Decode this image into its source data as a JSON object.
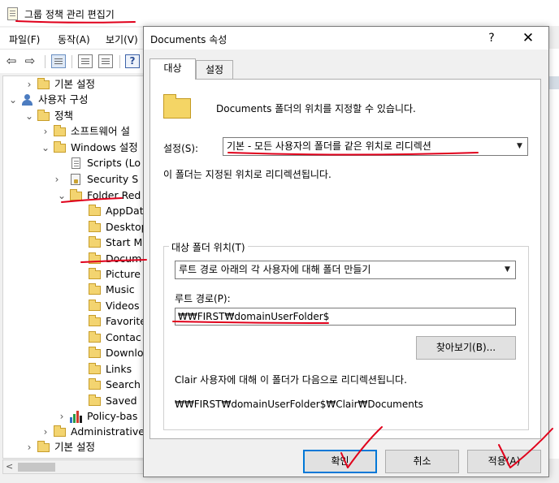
{
  "window": {
    "title": "그룹 정책 관리 편집기"
  },
  "menu": {
    "items": [
      "파일(F)",
      "동작(A)",
      "보기(V)"
    ]
  },
  "toolbar": {
    "back_icon": "back-arrow-icon",
    "forward_icon": "forward-arrow-icon",
    "help_label": "?"
  },
  "tree": {
    "nodes": [
      {
        "label": "기본 설정",
        "expander": "›"
      },
      {
        "label": "사용자 구성",
        "expander": "⌄"
      },
      {
        "label": "정책",
        "expander": "⌄"
      },
      {
        "label": "소프트웨어 설",
        "expander": "›"
      },
      {
        "label": "Windows 설정",
        "expander": "⌄"
      },
      {
        "label": "Scripts (Lo",
        "expander": ""
      },
      {
        "label": "Security S",
        "expander": "›"
      },
      {
        "label": "Folder Red",
        "expander": "⌄"
      },
      {
        "label": "AppDat",
        "expander": ""
      },
      {
        "label": "Desktop",
        "expander": ""
      },
      {
        "label": "Start M",
        "expander": ""
      },
      {
        "label": "Docum",
        "expander": ""
      },
      {
        "label": "Picture",
        "expander": ""
      },
      {
        "label": "Music",
        "expander": ""
      },
      {
        "label": "Videos",
        "expander": ""
      },
      {
        "label": "Favorite",
        "expander": ""
      },
      {
        "label": "Contac",
        "expander": ""
      },
      {
        "label": "Downlo",
        "expander": ""
      },
      {
        "label": "Links",
        "expander": ""
      },
      {
        "label": "Search",
        "expander": ""
      },
      {
        "label": "Saved",
        "expander": ""
      },
      {
        "label": "Policy-bas",
        "expander": "›"
      },
      {
        "label": "Administrative",
        "expander": "›"
      },
      {
        "label": "기본 설정",
        "expander": "›"
      }
    ]
  },
  "scrollbar": {
    "left_arrow": "<"
  },
  "dialog": {
    "title": "Documents 속성",
    "help_label": "?",
    "close_label": "✕",
    "tabs": [
      "대상",
      "설정"
    ],
    "description": "Documents 폴더의 위치를 지정할 수 있습니다.",
    "setting_label": "설정(S):",
    "setting_value": "기본 - 모든 사용자의 폴더를 같은 위치로 리디렉션",
    "setting_note": "이 폴더는 지정된 위치로 리디렉션됩니다.",
    "target_group_label": "대상 폴더 위치(T)",
    "target_value": "루트 경로 아래의 각 사용자에 대해 폴더 만들기",
    "root_path_label": "루트 경로(P):",
    "root_path_value": "₩₩FIRST₩domainUserFolder$",
    "browse_label": "찾아보기(B)...",
    "redirect_note": "Clair 사용자에 대해 이 폴더가 다음으로 리디렉션됩니다.",
    "redirect_path": "₩₩FIRST₩domainUserFolder$₩Clair₩Documents",
    "buttons": {
      "ok": "확인",
      "cancel": "취소",
      "apply": "적용(A)"
    }
  },
  "colors": {
    "annotation": "#e0001b",
    "accent": "#0078d7",
    "folder": "#f3d470"
  }
}
